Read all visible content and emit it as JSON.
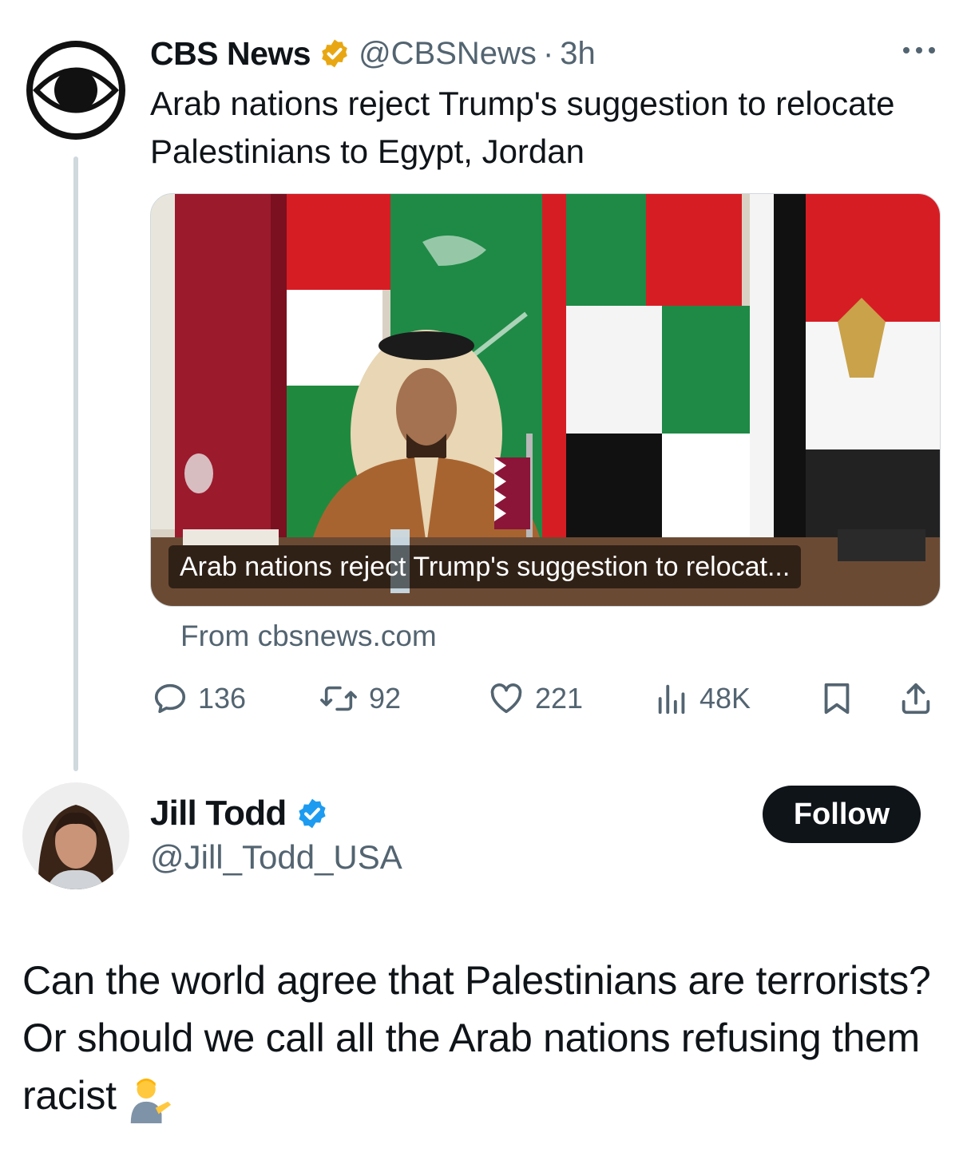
{
  "original_tweet": {
    "author_name": "CBS News",
    "verified_badge": "gold-verified-icon",
    "handle": "@CBSNews",
    "separator": "·",
    "time": "3h",
    "more_icon": "ellipsis-icon",
    "text": "Arab nations reject Trump's suggestion to relocate Palestinians to Egypt, Jordan",
    "link_card": {
      "image_description_icon": "article-photo",
      "caption": "Arab nations reject Trump's suggestion to relocat...",
      "source": "From cbsnews.com"
    },
    "actions": {
      "replies": "136",
      "reposts": "92",
      "likes": "221",
      "views": "48K"
    }
  },
  "reply_tweet": {
    "author_name": "Jill Todd",
    "verified_badge": "blue-verified-icon",
    "handle": "@Jill_Todd_USA",
    "follow_label": "Follow",
    "text": "Can the world agree that Palestinians are terrorists? Or should we call all the Arab nations refusing them racist",
    "emoji_icon": "person-tipping-hand-icon"
  },
  "colors": {
    "text_primary": "#0f1419",
    "text_secondary": "#536471",
    "thread_line": "#cfd9de",
    "gold_badge": "#e8a712",
    "blue_badge": "#1d9bf0",
    "follow_bg": "#0f1419"
  }
}
